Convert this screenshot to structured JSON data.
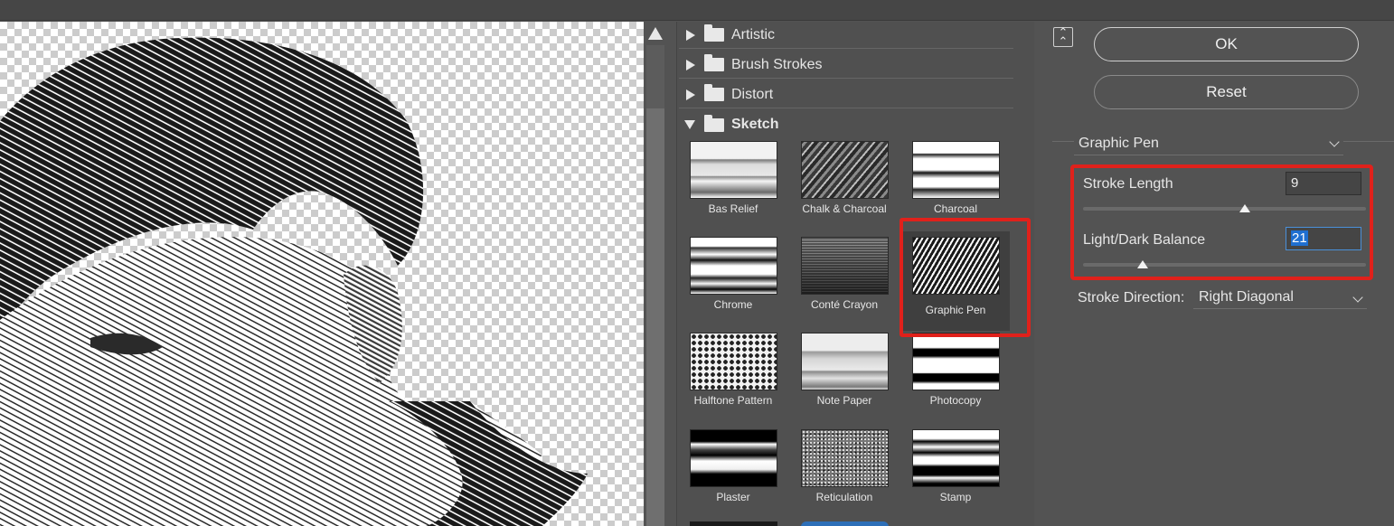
{
  "categories": [
    {
      "label": "Artistic",
      "expanded": false
    },
    {
      "label": "Brush Strokes",
      "expanded": false
    },
    {
      "label": "Distort",
      "expanded": false
    },
    {
      "label": "Sketch",
      "expanded": true
    }
  ],
  "thumbnails": [
    {
      "label": "Bas Relief",
      "selected": false
    },
    {
      "label": "Chalk & Charcoal",
      "selected": false
    },
    {
      "label": "Charcoal",
      "selected": false
    },
    {
      "label": "Chrome",
      "selected": false
    },
    {
      "label": "Conté Crayon",
      "selected": false
    },
    {
      "label": "Graphic Pen",
      "selected": true
    },
    {
      "label": "Halftone Pattern",
      "selected": false
    },
    {
      "label": "Note Paper",
      "selected": false
    },
    {
      "label": "Photocopy",
      "selected": false
    },
    {
      "label": "Plaster",
      "selected": false
    },
    {
      "label": "Reticulation",
      "selected": false
    },
    {
      "label": "Stamp",
      "selected": false
    }
  ],
  "buttons": {
    "ok": "OK",
    "reset": "Reset"
  },
  "filter": {
    "selected": "Graphic Pen",
    "stroke_length": {
      "label": "Stroke Length",
      "value": "9",
      "min": 1,
      "max": 15
    },
    "light_dark_balance": {
      "label": "Light/Dark Balance",
      "value": "21",
      "min": 0,
      "max": 100
    },
    "stroke_direction": {
      "label": "Stroke Direction:",
      "value": "Right Diagonal"
    }
  },
  "icons": {
    "collapse": "collapse-panel-icon",
    "folder": "folder-icon",
    "scroll_up": "scroll-up-arrow-icon",
    "dropdown": "chevron-down-icon"
  },
  "colors": {
    "highlight": "#e0211b",
    "panel_bg": "#535353",
    "selection": "#1f6fd1"
  }
}
